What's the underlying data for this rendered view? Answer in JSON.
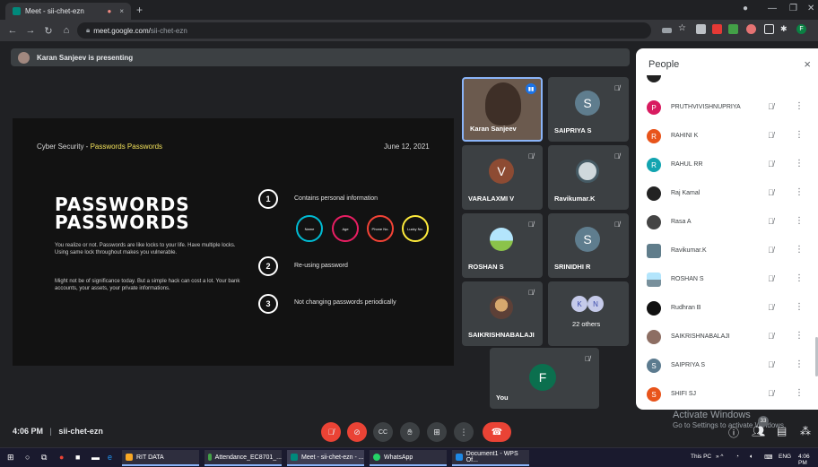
{
  "browser": {
    "tab_title": "Meet - sii-chet-ezn",
    "url_domain": "meet.google.com/",
    "url_path": "sii-chet-ezn",
    "new_tab": "+",
    "tab_close": "×"
  },
  "presenting": {
    "text": "Karan Sanjeev is presenting"
  },
  "slide": {
    "header_left_prefix": "Cyber Security - ",
    "header_left_accent": "Passwords Passwords",
    "date": "June 12, 2021",
    "title_line1": "PASSWORDS",
    "title_line2": "PASSWORDS",
    "para1": "You realize or not. Passwords are like locks to your life. Have multiple locks. Using same lock throughout makes you vulnerable.",
    "para2": "Might not be of significance today. But a simple hack can cost a lot. Your bank accounts, your assets, your private informations.",
    "points": [
      {
        "num": "1",
        "text": "Contains personal information"
      },
      {
        "num": "2",
        "text": "Re-using password"
      },
      {
        "num": "3",
        "text": "Not changing passwords periodically"
      }
    ],
    "circles": [
      "Name",
      "Age",
      "Phone No.",
      "Lucky No."
    ],
    "accent_color": "#f1e05a"
  },
  "tiles": [
    {
      "name": "Karan Sanjeev",
      "type": "video"
    },
    {
      "name": "SAIPRIYA S",
      "initial": "S",
      "color": "#5f7d8e"
    },
    {
      "name": "VARALAXMI V",
      "initial": "V",
      "color": "#8d4b33"
    },
    {
      "name": "Ravikumar.K",
      "type": "photo"
    },
    {
      "name": "ROSHAN S",
      "type": "photo"
    },
    {
      "name": "SRINIDHI R",
      "initial": "S",
      "color": "#5f7d8e"
    },
    {
      "name": "SAIKRISHNABALAJI",
      "type": "photo"
    },
    {
      "name": "22 others",
      "initials": [
        "K",
        "N"
      ]
    },
    {
      "name": "You",
      "initial": "F",
      "color": "#0b6f4e"
    }
  ],
  "people": {
    "title": "People",
    "close": "×",
    "list": [
      {
        "name": "PRUTHVIVISHNUPRIYA",
        "initial": "P",
        "color": "#d81b60"
      },
      {
        "name": "RAHINI K",
        "initial": "R",
        "color": "#e8541b"
      },
      {
        "name": "RAHUL RR",
        "initial": "R",
        "color": "#12a4b0"
      },
      {
        "name": "Raj Kamal",
        "initial": "",
        "color": "#222222"
      },
      {
        "name": "Rasa A",
        "initial": "",
        "color": "#444444"
      },
      {
        "name": "Ravikumar.K",
        "initial": "",
        "color": "#607d8b"
      },
      {
        "name": "ROSHAN S",
        "initial": "",
        "color": "#78909c"
      },
      {
        "name": "Rudhran B",
        "initial": "",
        "color": "#111111"
      },
      {
        "name": "SAIKRISHNABALAJI",
        "initial": "",
        "color": "#8d6e63"
      },
      {
        "name": "SAIPRIYA S",
        "initial": "S",
        "color": "#5c7b8f"
      },
      {
        "name": "SHIFI SJ",
        "initial": "S",
        "color": "#e8541b"
      }
    ]
  },
  "bottom": {
    "time": "4:06 PM",
    "separator": "|",
    "meeting_code": "sii-chet-ezn",
    "activate_title": "Activate Windows",
    "activate_sub": "Go to Settings to activate Windows.",
    "participant_count": "33"
  },
  "taskbar": {
    "items": [
      "RIT DATA",
      "Attendance_EC8701_...",
      "Meet - sii-chet-ezn - ...",
      "WhatsApp",
      "Document1 - WPS Of..."
    ],
    "this_pc": "This PC",
    "lang": "ENG",
    "clock": "4:06 PM"
  }
}
